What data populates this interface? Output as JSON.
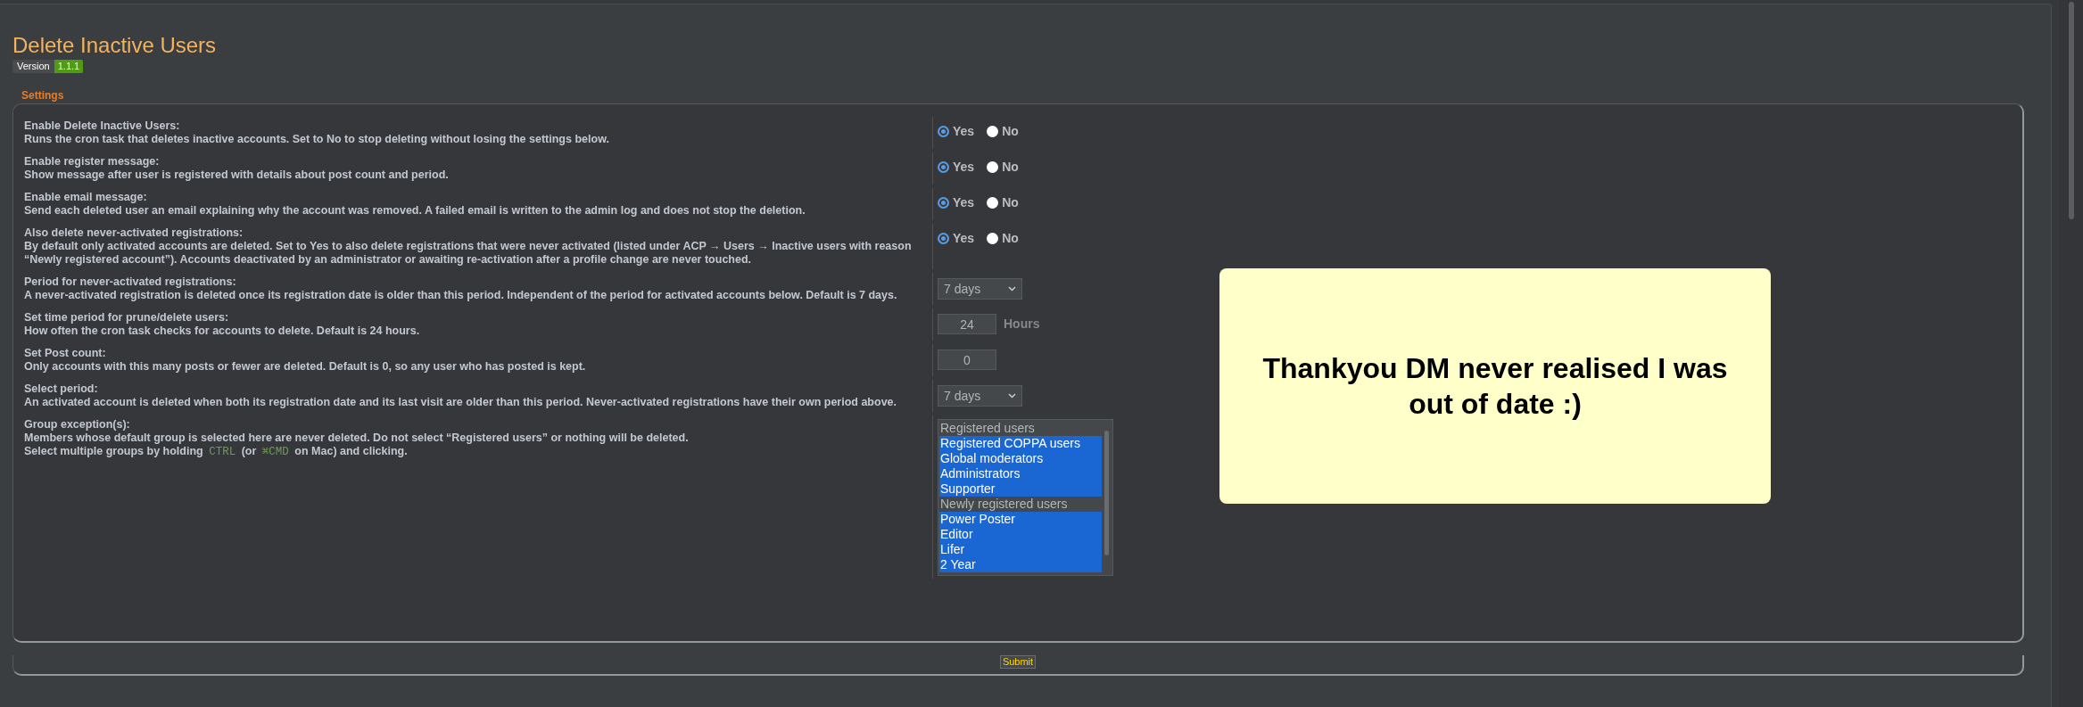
{
  "page": {
    "title": "Delete Inactive Users",
    "version_label": "Version",
    "version": "1.1.1"
  },
  "settings": {
    "legend": "Settings",
    "rows": [
      {
        "kind": "radio",
        "label": "Enable Delete Inactive Users:",
        "explain": [
          [
            {
              "kind": "text",
              "text": "Runs the cron task that deletes inactive accounts. Set to No to stop deleting without losing the settings below."
            }
          ]
        ],
        "options": [
          {
            "label": "Yes",
            "selected": true
          },
          {
            "label": "No",
            "selected": false
          }
        ]
      },
      {
        "kind": "radio",
        "label": "Enable register message:",
        "explain": [
          [
            {
              "kind": "text",
              "text": "Show message after user is registered with details about post count and period."
            }
          ]
        ],
        "options": [
          {
            "label": "Yes",
            "selected": true
          },
          {
            "label": "No",
            "selected": false
          }
        ]
      },
      {
        "kind": "radio",
        "label": "Enable email message:",
        "explain": [
          [
            {
              "kind": "text",
              "text": "Send each deleted user an email explaining why the account was removed. A failed email is written to the admin log and does not stop the deletion."
            }
          ]
        ],
        "options": [
          {
            "label": "Yes",
            "selected": true
          },
          {
            "label": "No",
            "selected": false
          }
        ]
      },
      {
        "kind": "radio",
        "label": "Also delete never-activated registrations:",
        "explain": [
          [
            {
              "kind": "text",
              "text": "By default only activated accounts are deleted. Set to Yes to also delete registrations that were never activated (listed under ACP → Users → Inactive users with reason “Newly registered account”). Accounts deactivated by an administrator or awaiting re-activation after a profile change are never touched."
            }
          ]
        ],
        "options": [
          {
            "label": "Yes",
            "selected": true
          },
          {
            "label": "No",
            "selected": false
          }
        ]
      },
      {
        "kind": "select",
        "label": "Period for never-activated registrations:",
        "explain": [
          [
            {
              "kind": "text",
              "text": "A never-activated registration is deleted once its registration date is older than this period. Independent of the period for activated accounts below. Default is 7 days."
            }
          ]
        ],
        "value": "7 days"
      },
      {
        "kind": "number",
        "label": "Set time period for prune/delete users:",
        "explain": [
          [
            {
              "kind": "text",
              "text": "How often the cron task checks for accounts to delete. Default is 24 hours."
            }
          ]
        ],
        "value": "24",
        "unit": "Hours"
      },
      {
        "kind": "number",
        "label": "Set Post count:",
        "explain": [
          [
            {
              "kind": "text",
              "text": "Only accounts with this many posts or fewer are deleted. Default is 0, so any user who has posted is kept."
            }
          ]
        ],
        "value": "0"
      },
      {
        "kind": "select",
        "label": "Select period:",
        "explain": [
          [
            {
              "kind": "text",
              "text": "An activated account is deleted when both its registration date and its last visit are older than this period. Never-activated registrations have their own period above."
            }
          ]
        ],
        "value": "7 days"
      },
      {
        "kind": "multiselect",
        "label": "Group exception(s):",
        "explain": [
          [
            {
              "kind": "text",
              "text": "Members whose default group is selected here are never deleted. Do not select “Registered users” or nothing will be deleted."
            }
          ],
          [
            {
              "kind": "text",
              "text": "Select multiple groups by holding "
            },
            {
              "kind": "key",
              "text": "CTRL"
            },
            {
              "kind": "text",
              "text": " (or "
            },
            {
              "kind": "key",
              "text": "⌘CMD"
            },
            {
              "kind": "text",
              "text": " on Mac) and clicking."
            }
          ]
        ],
        "items": [
          {
            "label": "Registered users",
            "selected": false
          },
          {
            "label": "Registered COPPA users",
            "selected": true
          },
          {
            "label": "Global moderators",
            "selected": true
          },
          {
            "label": "Administrators",
            "selected": true
          },
          {
            "label": "Supporter",
            "selected": true
          },
          {
            "label": "Newly registered users",
            "selected": false
          },
          {
            "label": "Power Poster",
            "selected": true
          },
          {
            "label": "Editor",
            "selected": true
          },
          {
            "label": "Lifer",
            "selected": true
          },
          {
            "label": "2 Year",
            "selected": true
          }
        ]
      }
    ]
  },
  "submit": "Submit",
  "note": "Thankyou DM never realised I was out of date :)"
}
